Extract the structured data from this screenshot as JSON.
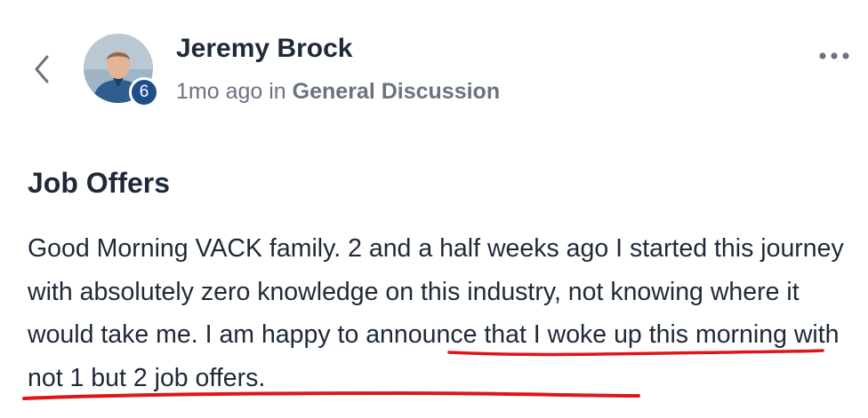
{
  "header": {
    "author_name": "Jeremy Brock",
    "badge_count": "6",
    "time_ago": "1mo ago",
    "in_word": "in",
    "category": "General Discussion",
    "back_icon": "chevron-left-icon",
    "more_icon": "more-horizontal-icon"
  },
  "post": {
    "title": "Job Offers",
    "body_intro": "Good Morning VACK family. 2 and a half weeks ago I started this journey with absolutely zero knowledge on this industry, not knowing where it would take me. ",
    "body_highlight": "I am happy to announce that I woke up this morning with not 1 but 2 job offers."
  },
  "colors": {
    "annotation": "#e0141b",
    "badge": "#1e4f8c",
    "text": "#1f2937",
    "muted": "#6b7280"
  }
}
